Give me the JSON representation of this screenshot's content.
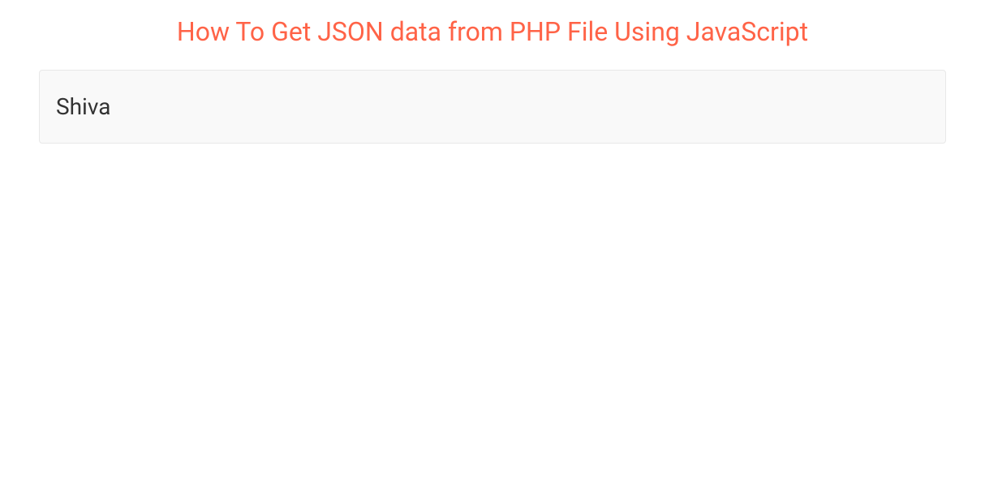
{
  "header": {
    "title": "How To Get JSON data from PHP File Using JavaScript"
  },
  "output": {
    "value": "Shiva"
  }
}
